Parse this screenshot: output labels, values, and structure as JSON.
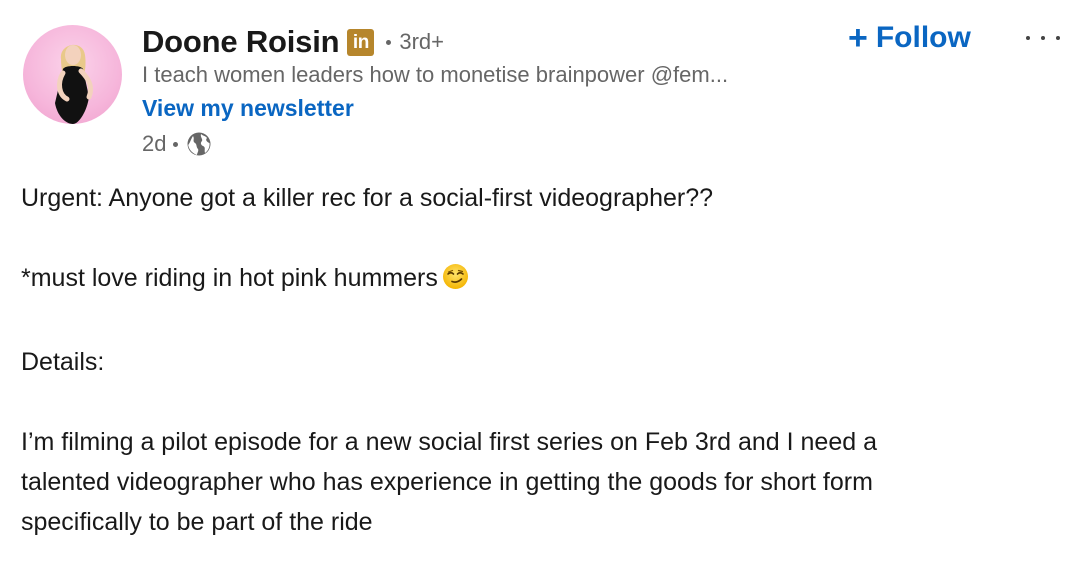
{
  "author": {
    "name": "Doone Roisin",
    "premium_badge": "in",
    "connection_degree": "3rd+",
    "headline": "I teach women leaders how to monetise brainpower @fem...",
    "newsletter_link": "View my newsletter",
    "timestamp": "2d",
    "visibility_icon": "globe-icon"
  },
  "actions": {
    "follow_label": "Follow",
    "follow_icon": "plus-icon",
    "more_icon": "ellipsis-icon"
  },
  "post": {
    "line1": "Urgent: Anyone got a killer rec for a social-first videographer??",
    "line2": "*must love riding in hot pink hummers",
    "line2_emoji": "smirking-face-emoji",
    "line3": "Details:",
    "line4": "I’m filming a pilot episode for a new social first series on Feb 3rd and I need a",
    "line5": "talented videographer who has experience in getting the goods for short form",
    "line6": "specifically to be part of the ride"
  },
  "colors": {
    "link_blue": "#0a66c2",
    "badge_gold": "#b6862c",
    "secondary_text": "#666666",
    "primary_text": "#191919"
  }
}
